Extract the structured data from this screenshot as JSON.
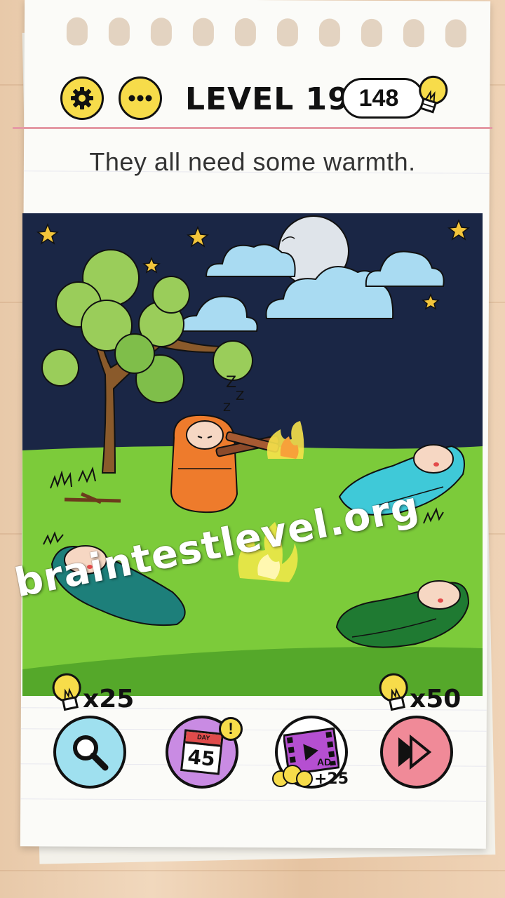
{
  "header": {
    "level_label": "LEVEL 199",
    "hint_count": "148",
    "settings_icon": "gear-icon",
    "menu_icon": "more-dots-icon",
    "hint_icon": "lightbulb-icon"
  },
  "question": "They all need some warmth.",
  "scene": {
    "sleepers": [
      "orange-sleeping-bag",
      "cyan-sleeping-bag",
      "teal-sleeping-bag",
      "green-sleeping-bag"
    ],
    "campfire": "campfire",
    "sleep_marks": "Z Z Z"
  },
  "boosters": {
    "hint": {
      "icon": "magnifier-icon",
      "cost": "x25"
    },
    "daily": {
      "icon": "calendar-icon",
      "day_label": "DAY",
      "day_number": "45",
      "badge": "!"
    },
    "video": {
      "icon": "video-ad-icon",
      "ad_label": "AD",
      "reward": "+25"
    },
    "skip": {
      "icon": "skip-icon",
      "cost": "x50"
    }
  },
  "watermark": "braintestlevel.org",
  "colors": {
    "accent_yellow": "#f7dc4a",
    "night_sky": "#1a2645",
    "grass": "#7ccb3a",
    "paper": "#fbfbf8",
    "daily_purple": "#c98be3",
    "skip_pink": "#f08a98"
  }
}
